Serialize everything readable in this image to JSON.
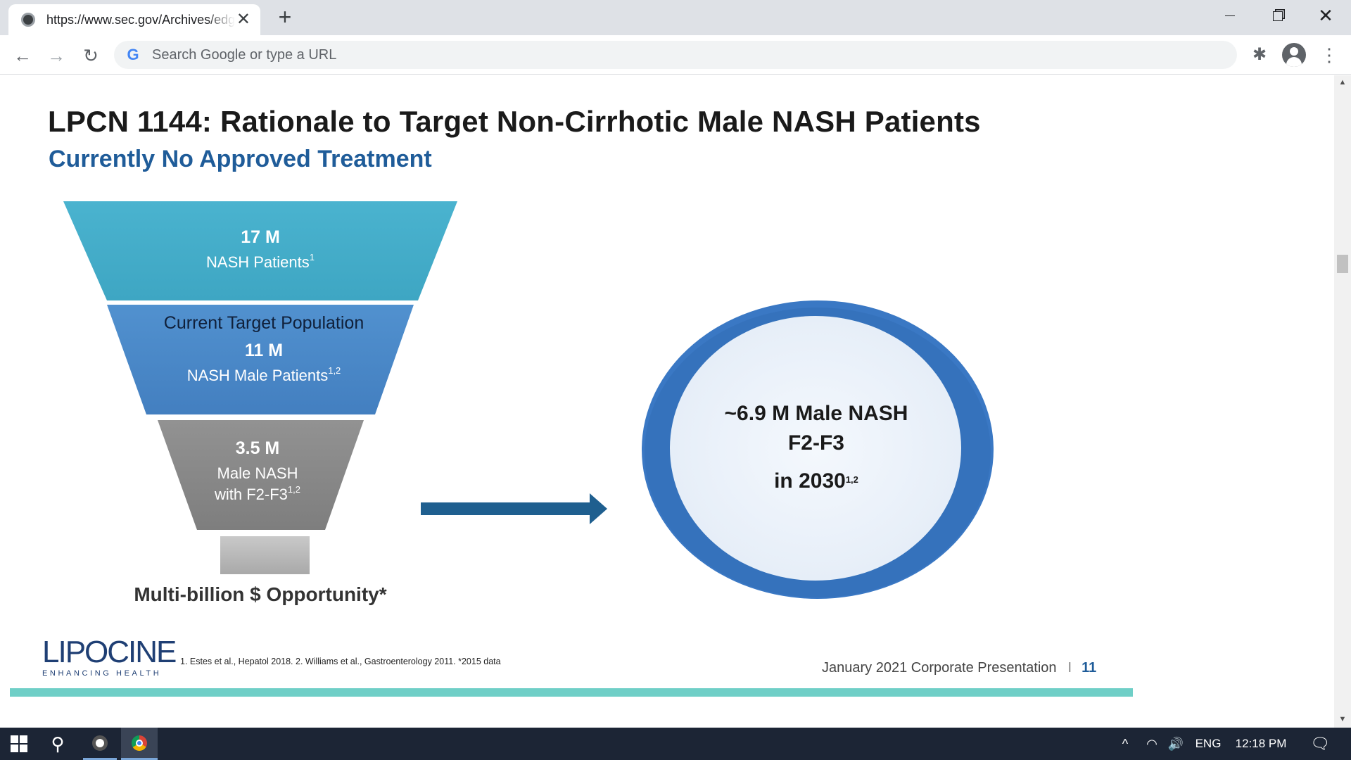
{
  "browser": {
    "tab_title": "https://www.sec.gov/Archives/edgar/data/",
    "tab_close": "✕",
    "new_tab": "+",
    "window": {
      "minimize": "",
      "restore": "",
      "close": "✕"
    },
    "nav": {
      "back": "←",
      "forward": "→",
      "reload": "↻"
    },
    "omnibox": {
      "google_glyph": "G",
      "placeholder": "Search Google or type a URL"
    },
    "extensions_glyph": "✱",
    "menu_glyph": "⋮"
  },
  "slide": {
    "title": "LPCN 1144: Rationale to Target Non-Cirrhotic Male NASH Patients",
    "subtitle": "Currently No Approved Treatment",
    "funnel": {
      "tier1": {
        "value": "17 M",
        "label": "NASH Patients",
        "sup": "1"
      },
      "tier2": {
        "heading": "Current Target Population",
        "value": "11 M",
        "label": "NASH Male Patients",
        "sup": "1,2"
      },
      "tier3": {
        "value": "3.5 M",
        "label_line1": "Male NASH",
        "label_line2": "with F2-F3",
        "sup": "1,2"
      }
    },
    "opportunity": "Multi-billion $ Opportunity*",
    "circle": {
      "line1": "~6.9 M Male NASH",
      "line2": "F2-F3",
      "line3": "in 2030",
      "sup": "1,2"
    },
    "logo": {
      "main": "LIPOCINE",
      "tagline": "ENHANCING HEALTH"
    },
    "footnote": "1.   Estes et al., Hepatol 2018.  2.  Williams  et al., Gastroenterology  2011.    *2015 data",
    "footer": {
      "text": "January  2021 Corporate Presentation",
      "separator": "I",
      "page": "11"
    },
    "colors": {
      "tier1": "#48b0cc",
      "tier2": "#4a86c8",
      "tier3": "#8a8a8a",
      "arrow": "#1f5f8f",
      "ring": "#3a78c4",
      "accent_bar": "#6fcfc7"
    }
  },
  "taskbar": {
    "search_glyph": "⚲",
    "tray": {
      "chevron": "^",
      "network": "◠",
      "volume": "🔊",
      "language": "ENG",
      "time": "12:18 PM",
      "notifications": "🗨"
    }
  }
}
